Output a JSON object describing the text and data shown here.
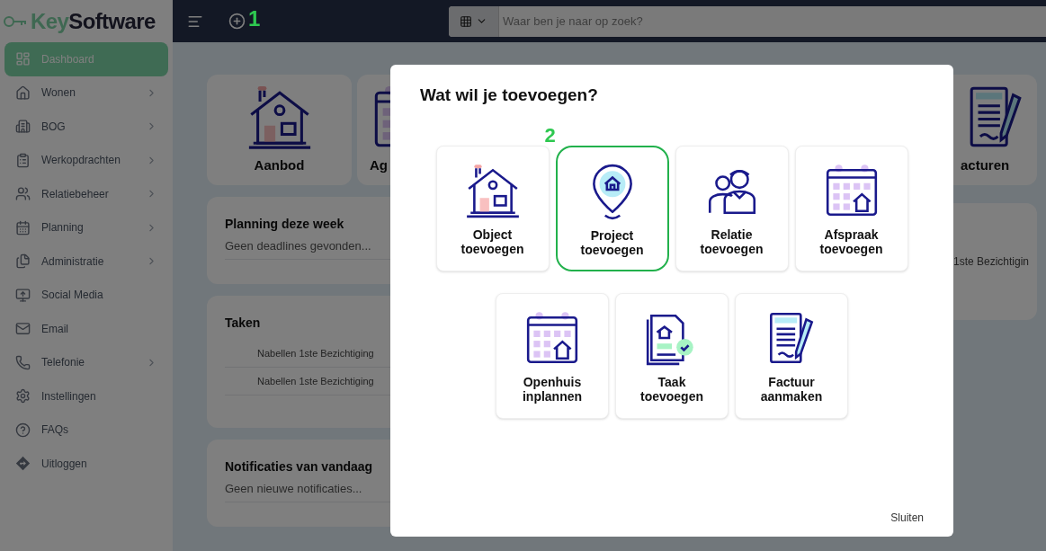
{
  "sidebar": {
    "logo": {
      "prefix": "Key",
      "suffix": "Software"
    },
    "items": [
      {
        "label": "Dashboard",
        "kind": "dashboard",
        "selected": true,
        "submenu": false
      },
      {
        "label": "Wonen",
        "kind": "home",
        "selected": false,
        "submenu": true
      },
      {
        "label": "BOG",
        "kind": "building",
        "selected": false,
        "submenu": true
      },
      {
        "label": "Werkopdrachten",
        "kind": "clipboard",
        "selected": false,
        "submenu": true
      },
      {
        "label": "Relatiebeheer",
        "kind": "people",
        "selected": false,
        "submenu": true
      },
      {
        "label": "Planning",
        "kind": "calendar",
        "selected": false,
        "submenu": true
      },
      {
        "label": "Administratie",
        "kind": "documents",
        "selected": false,
        "submenu": true
      },
      {
        "label": "Social Media",
        "kind": "screen",
        "selected": false,
        "submenu": false
      },
      {
        "label": "Email",
        "kind": "mail",
        "selected": false,
        "submenu": false
      },
      {
        "label": "Telefonie",
        "kind": "phone",
        "selected": false,
        "submenu": true
      },
      {
        "label": "Instellingen",
        "kind": "gear",
        "selected": false,
        "submenu": false
      },
      {
        "label": "FAQs",
        "kind": "help",
        "selected": false,
        "submenu": false
      },
      {
        "label": "Uitloggen",
        "kind": "exit",
        "selected": false,
        "submenu": false
      }
    ]
  },
  "header": {
    "annotation": "1",
    "search": {
      "placeholder": "Waar ben je naar op zoek?"
    }
  },
  "dashboard": {
    "tiles": [
      {
        "label": "Aanbod",
        "kind": "house"
      },
      {
        "label": "Ag",
        "kind": "calendar"
      },
      {
        "label": "acturen",
        "kind": "invoice"
      }
    ],
    "planning": {
      "title": "Planning deze week",
      "text": "Geen deadlines gevonden..."
    },
    "tasks": {
      "title": "Taken",
      "items": [
        "Nabellen 1ste Bezichtiging",
        "Nabellen 1ste Bezichtiging"
      ]
    },
    "notifications": {
      "title": "Notificaties van vandaag",
      "text": "Geen nieuwe notificaties..."
    },
    "side_task": "1ste Bezichtigin"
  },
  "modal": {
    "title": "Wat wil je toevoegen?",
    "options": [
      {
        "label": "Object toevoegen",
        "kind": "house",
        "highlighted": false
      },
      {
        "label": "Project toevoegen",
        "kind": "pin",
        "highlighted": true,
        "annotation": "2"
      },
      {
        "label": "Relatie toevoegen",
        "kind": "people",
        "highlighted": false
      },
      {
        "label": "Afspraak toevoegen",
        "kind": "calendar",
        "highlighted": false
      },
      {
        "label": "Openhuis inplannen",
        "kind": "calendar",
        "highlighted": false
      },
      {
        "label": "Taak toevoegen",
        "kind": "document",
        "highlighted": false
      },
      {
        "label": "Factuur aanmaken",
        "kind": "invoice",
        "highlighted": false
      }
    ],
    "close": "Sluiten"
  }
}
